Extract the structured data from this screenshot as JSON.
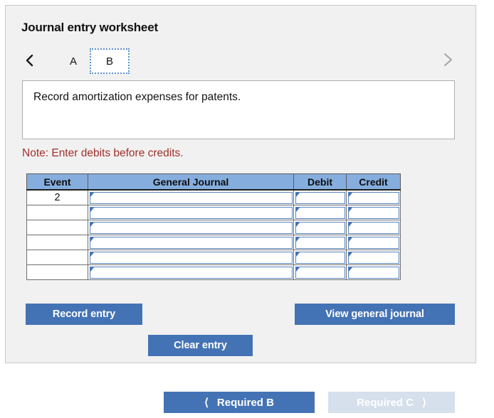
{
  "panel": {
    "title": "Journal entry worksheet"
  },
  "tabs": {
    "prev_icon": "chevron-left-icon",
    "next_icon": "chevron-right-icon",
    "items": [
      {
        "label": "A",
        "selected": false
      },
      {
        "label": "B",
        "selected": true
      }
    ]
  },
  "prompt": {
    "text": "Record amortization expenses for patents."
  },
  "note": {
    "text": "Note: Enter debits before credits."
  },
  "table": {
    "headers": [
      "Event",
      "General Journal",
      "Debit",
      "Credit"
    ],
    "rows": [
      {
        "event": "2",
        "general_journal": "",
        "debit": "",
        "credit": ""
      },
      {
        "event": "",
        "general_journal": "",
        "debit": "",
        "credit": ""
      },
      {
        "event": "",
        "general_journal": "",
        "debit": "",
        "credit": ""
      },
      {
        "event": "",
        "general_journal": "",
        "debit": "",
        "credit": ""
      },
      {
        "event": "",
        "general_journal": "",
        "debit": "",
        "credit": ""
      },
      {
        "event": "",
        "general_journal": "",
        "debit": "",
        "credit": ""
      }
    ]
  },
  "actions": {
    "record_entry": "Record entry",
    "clear_entry": "Clear entry",
    "view_general_journal": "View general journal"
  },
  "bottom_nav": {
    "prev": {
      "label": "Required B",
      "icon": "chevron-left-icon",
      "enabled": true
    },
    "next": {
      "label": "Required C",
      "icon": "chevron-right-icon",
      "enabled": false
    }
  },
  "colors": {
    "accent_blue": "#4473b5",
    "table_header_blue": "#85aedf",
    "disabled_blue": "#d6dfec",
    "note_red": "#a0302b",
    "panel_bg": "#f1f1f1"
  }
}
